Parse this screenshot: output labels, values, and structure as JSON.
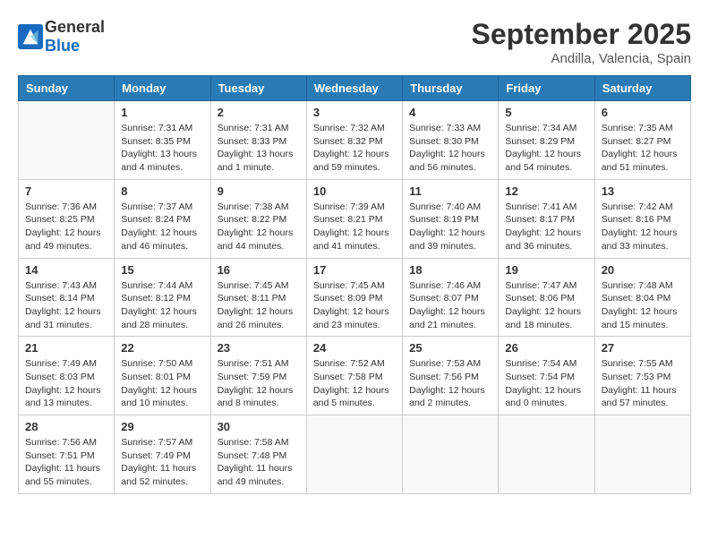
{
  "logo": {
    "general": "General",
    "blue": "Blue"
  },
  "title": "September 2025",
  "location": "Andilla, Valencia, Spain",
  "days_of_week": [
    "Sunday",
    "Monday",
    "Tuesday",
    "Wednesday",
    "Thursday",
    "Friday",
    "Saturday"
  ],
  "weeks": [
    [
      {
        "day": "",
        "info": ""
      },
      {
        "day": "1",
        "info": "Sunrise: 7:31 AM\nSunset: 8:35 PM\nDaylight: 13 hours\nand 4 minutes."
      },
      {
        "day": "2",
        "info": "Sunrise: 7:31 AM\nSunset: 8:33 PM\nDaylight: 13 hours\nand 1 minute."
      },
      {
        "day": "3",
        "info": "Sunrise: 7:32 AM\nSunset: 8:32 PM\nDaylight: 12 hours\nand 59 minutes."
      },
      {
        "day": "4",
        "info": "Sunrise: 7:33 AM\nSunset: 8:30 PM\nDaylight: 12 hours\nand 56 minutes."
      },
      {
        "day": "5",
        "info": "Sunrise: 7:34 AM\nSunset: 8:29 PM\nDaylight: 12 hours\nand 54 minutes."
      },
      {
        "day": "6",
        "info": "Sunrise: 7:35 AM\nSunset: 8:27 PM\nDaylight: 12 hours\nand 51 minutes."
      }
    ],
    [
      {
        "day": "7",
        "info": "Sunrise: 7:36 AM\nSunset: 8:25 PM\nDaylight: 12 hours\nand 49 minutes."
      },
      {
        "day": "8",
        "info": "Sunrise: 7:37 AM\nSunset: 8:24 PM\nDaylight: 12 hours\nand 46 minutes."
      },
      {
        "day": "9",
        "info": "Sunrise: 7:38 AM\nSunset: 8:22 PM\nDaylight: 12 hours\nand 44 minutes."
      },
      {
        "day": "10",
        "info": "Sunrise: 7:39 AM\nSunset: 8:21 PM\nDaylight: 12 hours\nand 41 minutes."
      },
      {
        "day": "11",
        "info": "Sunrise: 7:40 AM\nSunset: 8:19 PM\nDaylight: 12 hours\nand 39 minutes."
      },
      {
        "day": "12",
        "info": "Sunrise: 7:41 AM\nSunset: 8:17 PM\nDaylight: 12 hours\nand 36 minutes."
      },
      {
        "day": "13",
        "info": "Sunrise: 7:42 AM\nSunset: 8:16 PM\nDaylight: 12 hours\nand 33 minutes."
      }
    ],
    [
      {
        "day": "14",
        "info": "Sunrise: 7:43 AM\nSunset: 8:14 PM\nDaylight: 12 hours\nand 31 minutes."
      },
      {
        "day": "15",
        "info": "Sunrise: 7:44 AM\nSunset: 8:12 PM\nDaylight: 12 hours\nand 28 minutes."
      },
      {
        "day": "16",
        "info": "Sunrise: 7:45 AM\nSunset: 8:11 PM\nDaylight: 12 hours\nand 26 minutes."
      },
      {
        "day": "17",
        "info": "Sunrise: 7:45 AM\nSunset: 8:09 PM\nDaylight: 12 hours\nand 23 minutes."
      },
      {
        "day": "18",
        "info": "Sunrise: 7:46 AM\nSunset: 8:07 PM\nDaylight: 12 hours\nand 21 minutes."
      },
      {
        "day": "19",
        "info": "Sunrise: 7:47 AM\nSunset: 8:06 PM\nDaylight: 12 hours\nand 18 minutes."
      },
      {
        "day": "20",
        "info": "Sunrise: 7:48 AM\nSunset: 8:04 PM\nDaylight: 12 hours\nand 15 minutes."
      }
    ],
    [
      {
        "day": "21",
        "info": "Sunrise: 7:49 AM\nSunset: 8:03 PM\nDaylight: 12 hours\nand 13 minutes."
      },
      {
        "day": "22",
        "info": "Sunrise: 7:50 AM\nSunset: 8:01 PM\nDaylight: 12 hours\nand 10 minutes."
      },
      {
        "day": "23",
        "info": "Sunrise: 7:51 AM\nSunset: 7:59 PM\nDaylight: 12 hours\nand 8 minutes."
      },
      {
        "day": "24",
        "info": "Sunrise: 7:52 AM\nSunset: 7:58 PM\nDaylight: 12 hours\nand 5 minutes."
      },
      {
        "day": "25",
        "info": "Sunrise: 7:53 AM\nSunset: 7:56 PM\nDaylight: 12 hours\nand 2 minutes."
      },
      {
        "day": "26",
        "info": "Sunrise: 7:54 AM\nSunset: 7:54 PM\nDaylight: 12 hours\nand 0 minutes."
      },
      {
        "day": "27",
        "info": "Sunrise: 7:55 AM\nSunset: 7:53 PM\nDaylight: 11 hours\nand 57 minutes."
      }
    ],
    [
      {
        "day": "28",
        "info": "Sunrise: 7:56 AM\nSunset: 7:51 PM\nDaylight: 11 hours\nand 55 minutes."
      },
      {
        "day": "29",
        "info": "Sunrise: 7:57 AM\nSunset: 7:49 PM\nDaylight: 11 hours\nand 52 minutes."
      },
      {
        "day": "30",
        "info": "Sunrise: 7:58 AM\nSunset: 7:48 PM\nDaylight: 11 hours\nand 49 minutes."
      },
      {
        "day": "",
        "info": ""
      },
      {
        "day": "",
        "info": ""
      },
      {
        "day": "",
        "info": ""
      },
      {
        "day": "",
        "info": ""
      }
    ]
  ]
}
